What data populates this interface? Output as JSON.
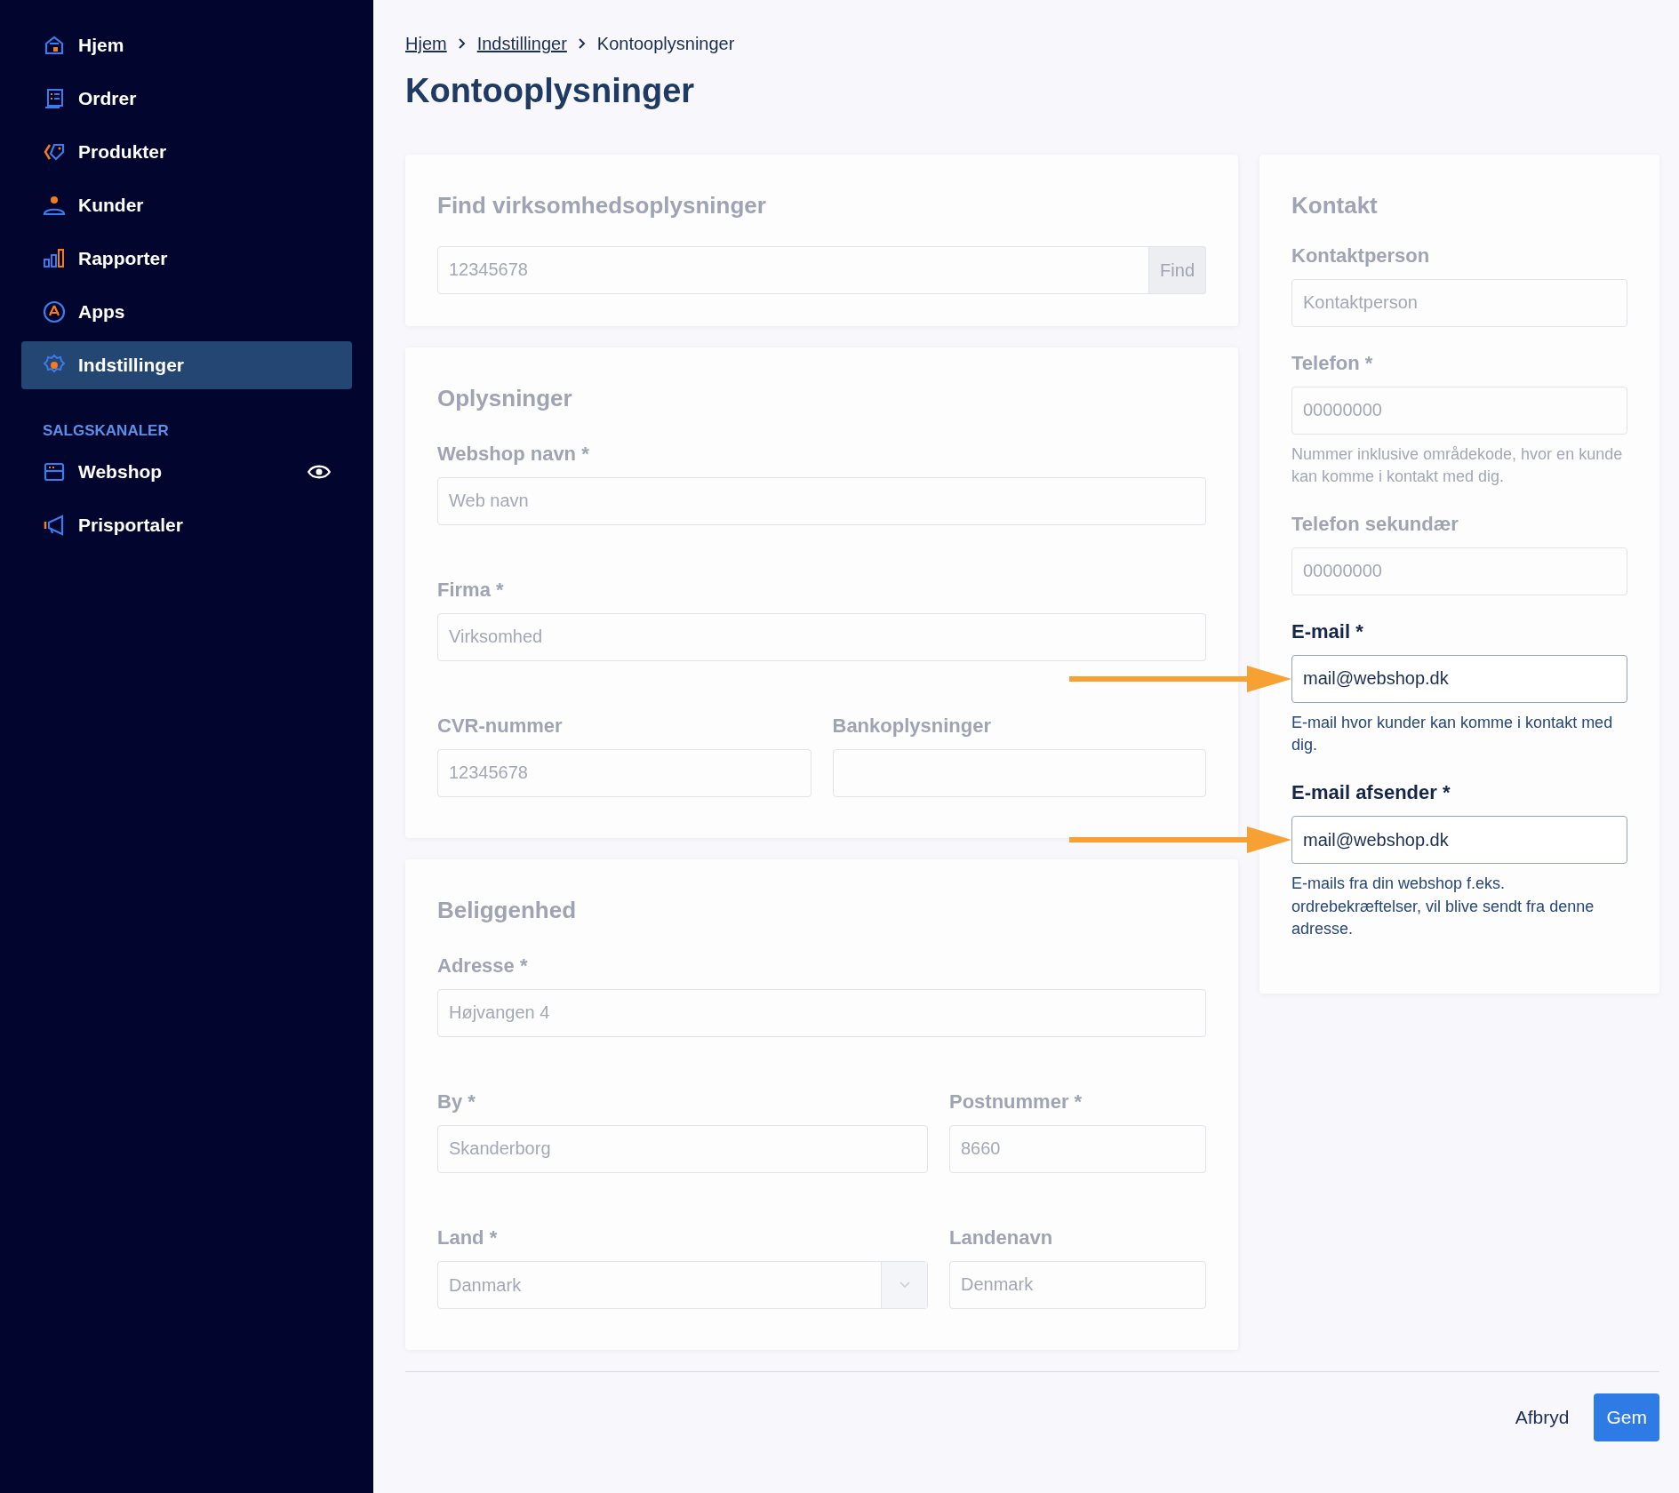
{
  "sidebar": {
    "items": [
      {
        "label": "Hjem",
        "selected": false
      },
      {
        "label": "Ordrer",
        "selected": false
      },
      {
        "label": "Produkter",
        "selected": false
      },
      {
        "label": "Kunder",
        "selected": false
      },
      {
        "label": "Rapporter",
        "selected": false
      },
      {
        "label": "Apps",
        "selected": false
      },
      {
        "label": "Indstillinger",
        "selected": true
      }
    ],
    "section_title": "SALGSKANALER",
    "channels": [
      {
        "label": "Webshop",
        "visible": true,
        "selected": false
      },
      {
        "label": "Prisportaler",
        "visible": false,
        "selected": false
      }
    ]
  },
  "breadcrumb": [
    {
      "label": "Hjem",
      "kind": "link"
    },
    {
      "label": "Indstillinger",
      "kind": "link"
    },
    {
      "label": "Kontooplysninger",
      "kind": "current"
    }
  ],
  "title": "Kontooplysninger",
  "left_cards": [
    {
      "kind": "search",
      "title": "Find virksomhedsoplysninger",
      "highlighted": false,
      "rows": [
        [
          {
            "kind": "search",
            "placeholder": "12345678",
            "button": "Find",
            "highlighted": false
          }
        ]
      ]
    },
    {
      "kind": "company",
      "title": "Oplysninger",
      "highlighted": false,
      "rows": [
        [
          {
            "kind": "text",
            "label": "Webshop navn *",
            "placeholder": "Web navn",
            "highlighted": false
          }
        ],
        [
          {
            "kind": "text",
            "label": "Firma *",
            "placeholder": "Virksomhed",
            "highlighted": false
          }
        ],
        [
          {
            "kind": "text",
            "label": "CVR-nummer",
            "placeholder": "12345678",
            "highlighted": false
          },
          {
            "kind": "text",
            "label": "Bankoplysninger",
            "highlighted": false
          }
        ]
      ]
    },
    {
      "kind": "location",
      "title": "Beliggenhed",
      "highlighted": false,
      "rows": [
        [
          {
            "kind": "text",
            "label": "Adresse *",
            "placeholder": "Højvangen 4",
            "highlighted": false
          }
        ],
        [
          {
            "kind": "text",
            "label": "By *",
            "placeholder": "Skanderborg",
            "highlighted": false
          },
          {
            "kind": "text",
            "label": "Postnummer *",
            "placeholder": "8660",
            "highlighted": false
          }
        ],
        [
          {
            "kind": "select",
            "label": "Land *",
            "placeholder": "Danmark",
            "highlighted": false
          },
          {
            "kind": "text",
            "label": "Landenavn",
            "placeholder": "Denmark",
            "highlighted": false
          }
        ]
      ]
    }
  ],
  "contact_card": {
    "title": "Kontakt",
    "highlighted": false,
    "fields": [
      {
        "kind": "text",
        "label": "Kontaktperson",
        "placeholder": "Kontaktperson",
        "highlighted": false
      },
      {
        "kind": "text",
        "label": "Telefon *",
        "placeholder": "00000000",
        "help": "Nummer inklusive områdekode, hvor en kunde kan komme i kontakt med dig.",
        "highlighted": false
      },
      {
        "kind": "text",
        "label": "Telefon sekundær",
        "placeholder": "00000000",
        "highlighted": false
      },
      {
        "kind": "text",
        "label": "E-mail *",
        "value": "mail@webshop.dk",
        "help": "E-mail hvor kunder kan komme i kontakt med dig.",
        "highlighted": true
      },
      {
        "kind": "text",
        "label": "E-mail afsender *",
        "value": "mail@webshop.dk",
        "help": "E-mails fra din webshop f.eks. ordrebekræftelser, vil blive sendt fra denne adresse.",
        "highlighted": true
      }
    ]
  },
  "footer": {
    "cancel": "Afbryd",
    "save": "Gem"
  }
}
